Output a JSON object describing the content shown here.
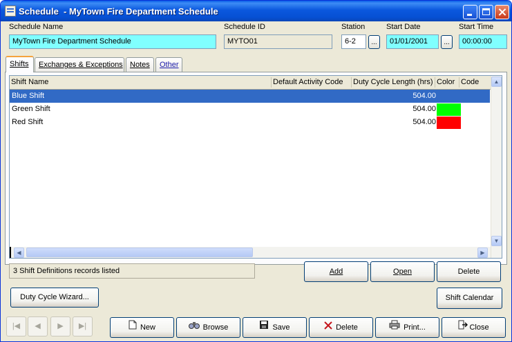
{
  "window": {
    "title": "Schedule  - MyTown Fire Department Schedule"
  },
  "header": {
    "schedule_name_label": "Schedule Name",
    "schedule_name_value": "MyTown Fire Department Schedule",
    "schedule_id_label": "Schedule ID",
    "schedule_id_value": "MYTO01",
    "station_label": "Station",
    "station_value": "6-2",
    "start_date_label": "Start Date",
    "start_date_value": "01/01/2001",
    "start_time_label": "Start Time",
    "start_time_value": "00:00:00",
    "ellipsis": "..."
  },
  "tabs": [
    {
      "label": "Shifts"
    },
    {
      "label": "Exchanges & Exceptions"
    },
    {
      "label": "Notes"
    },
    {
      "label": "Other"
    }
  ],
  "grid": {
    "columns": [
      "Shift Name",
      "Default Activity Code",
      "Duty Cycle Length (hrs)",
      "Color",
      "Code"
    ],
    "rows": [
      {
        "name": "Blue Shift",
        "activity_code": "",
        "length": "504.00",
        "color": "",
        "code": ""
      },
      {
        "name": "Green Shift",
        "activity_code": "",
        "length": "504.00",
        "color": "#00ff00",
        "code": ""
      },
      {
        "name": "Red Shift",
        "activity_code": "",
        "length": "504.00",
        "color": "#ff0000",
        "code": ""
      }
    ]
  },
  "status": {
    "text": "3 Shift Definitions records listed"
  },
  "buttons": {
    "add": "Add",
    "open": "Open",
    "delete": "Delete",
    "duty_cycle_wizard": "Duty Cycle Wizard...",
    "shift_calendar": "Shift Calendar"
  },
  "toolbar": {
    "new": "New",
    "browse": "Browse",
    "save": "Save",
    "delete": "Delete",
    "print": "Print...",
    "close": "Close"
  },
  "colors": {
    "title_bar": "#0a5de8",
    "selection": "#316ac5",
    "field_highlight": "#80ffff"
  }
}
